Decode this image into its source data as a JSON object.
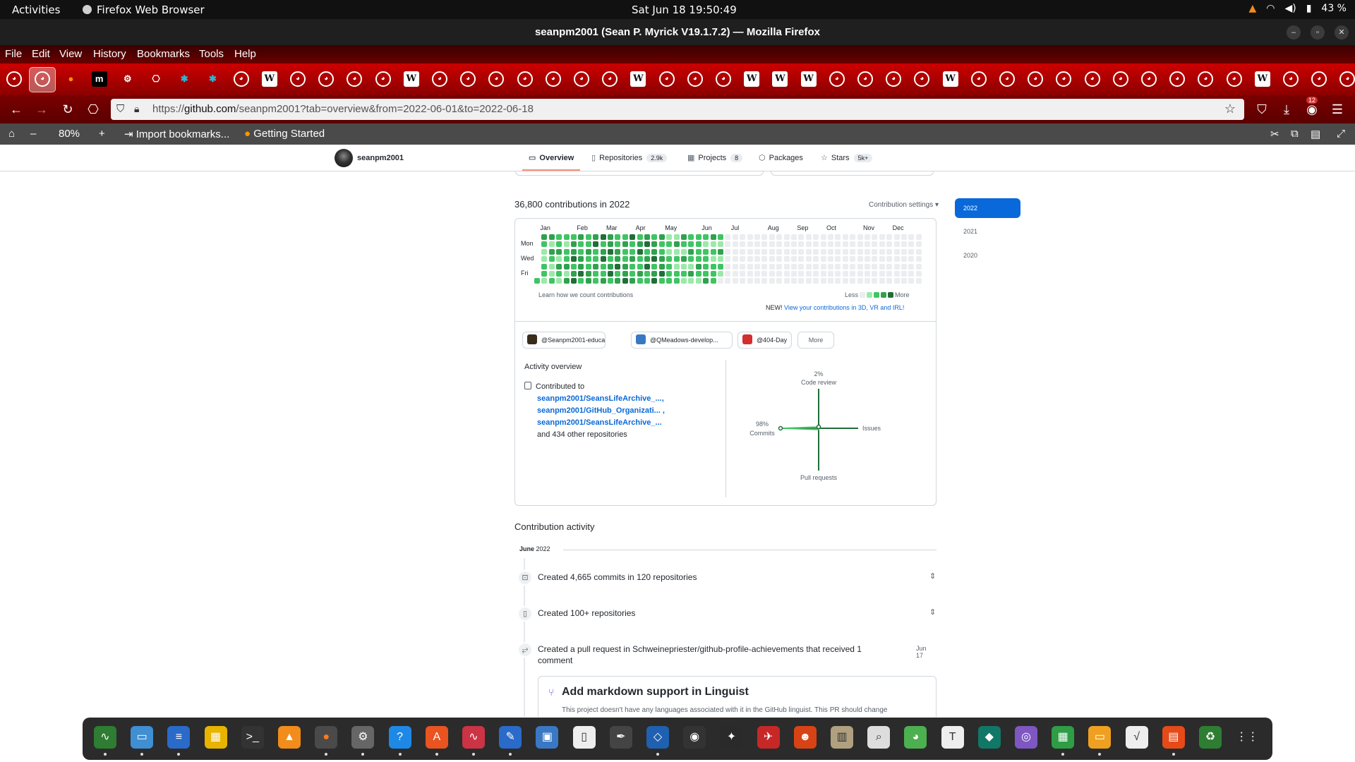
{
  "gnome_bar": {
    "activities": "Activities",
    "app_name": "Firefox Web Browser",
    "clock": "Sat Jun 18  19:50:49",
    "battery": "43 %"
  },
  "window": {
    "title": "seanpm2001 (Sean P. Myrick V19.1.7.2) — Mozilla Firefox"
  },
  "menu": [
    "File",
    "Edit",
    "View",
    "History",
    "Bookmarks",
    "Tools",
    "Help"
  ],
  "toolbar_icons": [
    "github",
    "github-active",
    "firefox",
    "m",
    "gear",
    "puzzle",
    "asterisk",
    "asterisk",
    "github",
    "wiki",
    "github",
    "github",
    "github",
    "github",
    "wiki",
    "github",
    "github",
    "github",
    "github",
    "github",
    "github",
    "github",
    "wiki",
    "github",
    "github",
    "github",
    "wiki",
    "wiki",
    "wiki",
    "github",
    "github",
    "github",
    "github",
    "wiki",
    "github",
    "github",
    "github",
    "github",
    "github",
    "github",
    "github",
    "github",
    "github",
    "github",
    "wiki",
    "github",
    "github",
    "github",
    "github"
  ],
  "nav": {
    "url_domain": "github.com",
    "url_prefix": "https://",
    "url_path": "/seanpm2001?tab=overview&from=2022-06-01&to=2022-06-18",
    "extension_badge": "12"
  },
  "bookmarks_bar": {
    "zoom": "80%",
    "import": "Import bookmarks...",
    "getting_started": "Getting Started"
  },
  "profile": {
    "username": "seanpm2001",
    "tabs": [
      {
        "label": "Overview",
        "count": ""
      },
      {
        "label": "Repositories",
        "count": "2.9k"
      },
      {
        "label": "Projects",
        "count": "8"
      },
      {
        "label": "Packages",
        "count": ""
      },
      {
        "label": "Stars",
        "count": "5k+"
      }
    ]
  },
  "contributions": {
    "title": "36,800 contributions in 2022",
    "settings": "Contribution settings ▾",
    "months": [
      "Jan",
      "Feb",
      "Mar",
      "Apr",
      "May",
      "Jun",
      "Jul",
      "Aug",
      "Sep",
      "Oct",
      "Nov",
      "Dec"
    ],
    "days": [
      "Mon",
      "Wed",
      "Fri"
    ],
    "learn_how": "Learn how we count contributions",
    "less": "Less",
    "more": "More",
    "new_label": "NEW!",
    "new_link": "View your contributions in 3D, VR and IRL!",
    "levels": [
      "#ebedf0",
      "#9be9a8",
      "#40c463",
      "#30a14e",
      "#216e39"
    ]
  },
  "orgs": [
    {
      "label": "@Seanpm2001-educati...",
      "color": "#3b2b1b"
    },
    {
      "label": "@QMeadows-develop...",
      "color": "#3a78c3"
    },
    {
      "label": "@404-Day",
      "color": "#d32f2f"
    },
    {
      "label": "More",
      "color": ""
    }
  ],
  "activity": {
    "title": "Activity overview",
    "contributed_to": "Contributed to",
    "repos": [
      "seanpm2001/SeansLifeArchive_...,",
      "seanpm2001/GitHub_Organizati... ,",
      "seanpm2001/SeansLifeArchive_..."
    ],
    "other": "and 434 other repositories",
    "code_review_pct": "2%",
    "code_review": "Code review",
    "commits_pct": "98%",
    "commits": "Commits",
    "issues": "Issues",
    "pull_requests": "Pull requests"
  },
  "timeline": {
    "title": "Contribution activity",
    "month": "June",
    "year": "2022",
    "items": [
      {
        "text": "Created 4,665 commits in 120 repositories",
        "date": ""
      },
      {
        "text": "Created 100+ repositories",
        "date": ""
      },
      {
        "text": "Created a pull request in Schweinepriester/github-profile-achievements that received 1 comment",
        "date": "Jun 17"
      }
    ],
    "pr_title": "Add markdown support in Linguist",
    "pr_desc": "This project doesn't have any languages associated with it in the GitHub linguist. This PR should change"
  },
  "years": [
    "2022",
    "2021",
    "2020"
  ],
  "dock_apps": [
    "system-monitor",
    "files",
    "writer",
    "calc",
    "terminal",
    "vlc",
    "firefox",
    "settings",
    "help",
    "app-store",
    "monitor",
    "text-editor",
    "toolbox",
    "document",
    "inkscape",
    "virtualbox",
    "obs",
    "pen",
    "game",
    "mario",
    "archive",
    "screenshot",
    "chrome",
    "typora",
    "gitkraken",
    "tor",
    "sheets",
    "slides",
    "formula",
    "impress",
    "trash",
    "app-grid"
  ]
}
